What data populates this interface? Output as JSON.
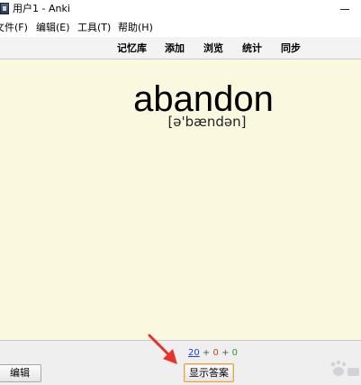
{
  "window": {
    "title": "用户1 - Anki"
  },
  "menubar": {
    "items": [
      {
        "label": "文件(F)"
      },
      {
        "label": "编辑(E)"
      },
      {
        "label": "工具(T)"
      },
      {
        "label": "帮助(H)"
      }
    ]
  },
  "toolbar": {
    "links": [
      {
        "label": "记忆库"
      },
      {
        "label": "添加"
      },
      {
        "label": "浏览"
      },
      {
        "label": "统计"
      },
      {
        "label": "同步"
      }
    ]
  },
  "card": {
    "front": "abandon",
    "phonetic": "[ə'bændən]"
  },
  "bottom": {
    "edit_label": "编辑",
    "show_answer_label": "显示答案",
    "counts": {
      "new": "20",
      "learning": "0",
      "review": "0",
      "separator": "+"
    }
  },
  "colors": {
    "card_background": "#fbf8e0",
    "new_count": "#1f3fd0",
    "learning_count": "#d0421f",
    "review_count": "#2f9a2f",
    "annotation_arrow": "#e8322a"
  },
  "icons": {
    "app": "anki-icon",
    "minimize": "minimize-icon"
  }
}
